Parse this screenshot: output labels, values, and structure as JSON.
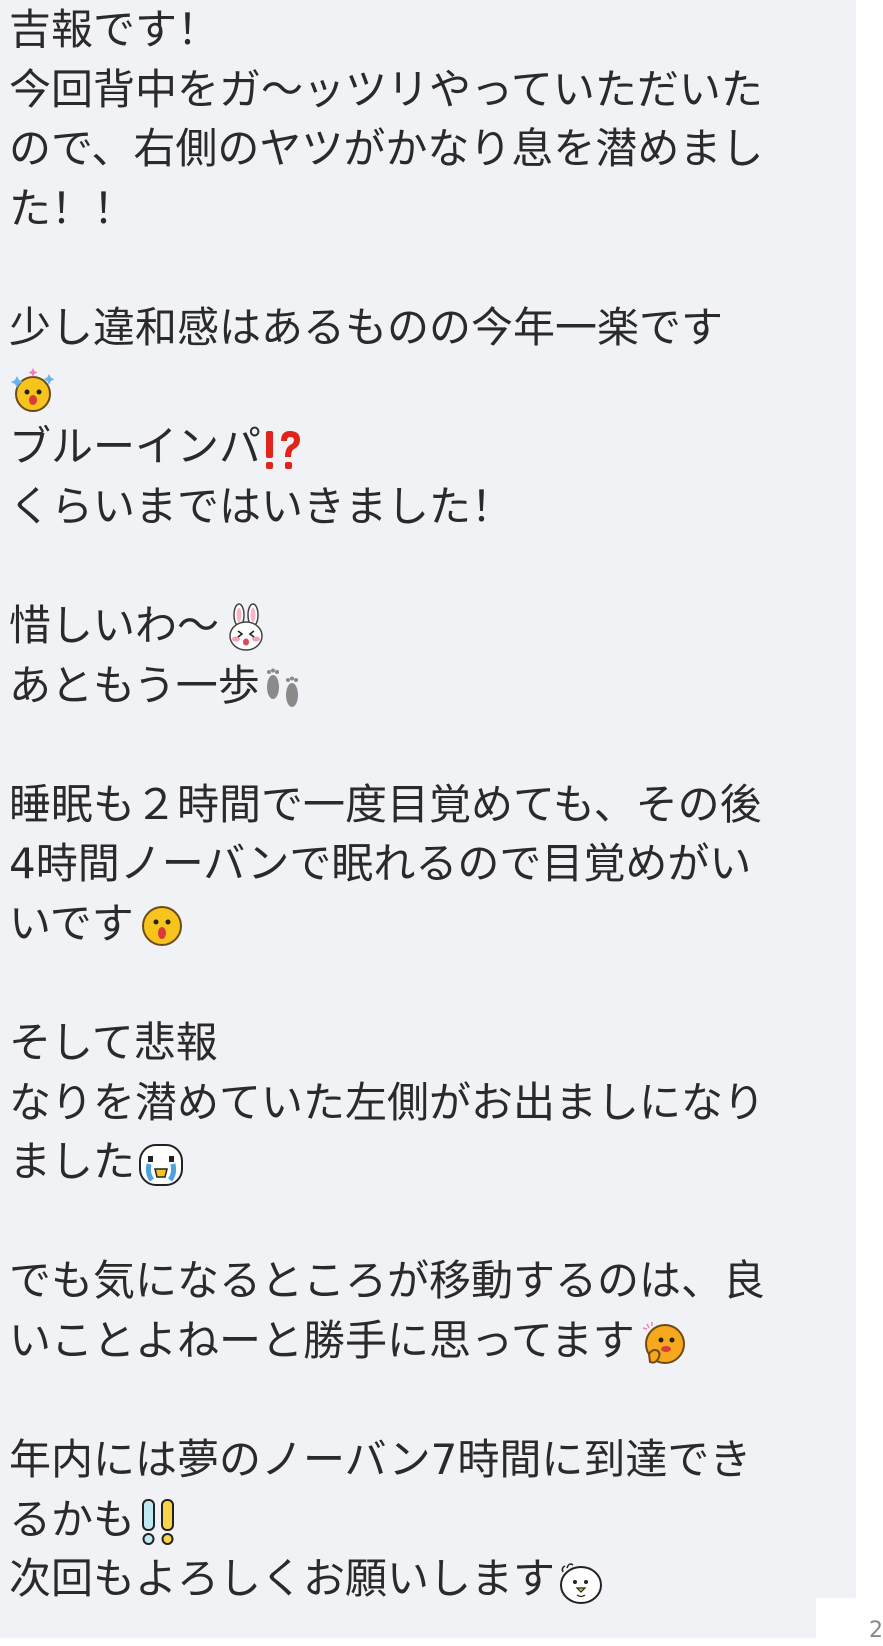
{
  "message": {
    "lines": [
      "吉報です！",
      "今回背中をガ〜ッツリやっていただいた",
      "ので、右側のヤツがかなり息を潜めまし",
      "た！！",
      "",
      "少し違和感はあるものの今年一楽です",
      "",
      "ブルーインパ",
      "くらいまではいきました！",
      "",
      "惜しいわ〜",
      "あともう一歩",
      "",
      "睡眠も２時間で一度目覚めても、その後",
      "4時間ノーバンで眠れるので目覚めがい",
      "いです",
      "",
      "そして悲報",
      "なりを潜めていた左側がお出ましになり",
      "ました",
      "",
      "でも気になるところが移動するのは、良",
      "いことよねーと勝手に思ってます",
      "",
      "年内には夢のノーバン7時間に到達でき",
      "るかも",
      "次回もよろしくお願いします"
    ],
    "emoji": {
      "sparkle_face": "sparkle-face-sticker-icon",
      "interrobang": "⁉️",
      "bunny": "bunny-sticker-icon",
      "footprints": "footprints-icon",
      "surprised_face": "surprised-face-sticker-icon",
      "crying_bird": "crying-bird-sticker-icon",
      "thinking_face": "thinking-face-sticker-icon",
      "exclamations": "double-exclamation-icon",
      "chick": "chick-sticker-icon"
    }
  },
  "corner_mark": "2",
  "colors": {
    "bubble_bg": "#f1f2f5",
    "text": "#2a2a2a",
    "interrobang": "#e0231b"
  }
}
